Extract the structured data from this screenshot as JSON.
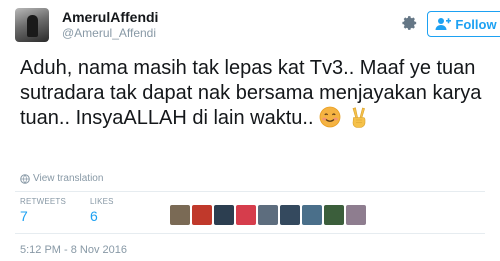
{
  "header": {
    "fullname": "AmerulAffendi",
    "username": "@Amerul_Affendi",
    "follow_label": "Follow"
  },
  "tweet": {
    "text": "Aduh, nama masih tak lepas kat Tv3.. Maaf ye tuan sutradara tak dapat nak bersama menjayakan karya tuan.. InsyaALLAH di lain waktu..",
    "emojis": [
      "smiling-face-emoji",
      "victory-hand-emoji"
    ]
  },
  "translate_label": "View translation",
  "stats": {
    "retweets_label": "RETWEETS",
    "retweets_count": "7",
    "likes_label": "LIKES",
    "likes_count": "6"
  },
  "likers": [
    {
      "name": "liker-avatar-1",
      "color": "#7a6a55"
    },
    {
      "name": "liker-avatar-2",
      "color": "#c0392b"
    },
    {
      "name": "liker-avatar-3",
      "color": "#2c3e50"
    },
    {
      "name": "liker-avatar-4",
      "color": "#d63d4c"
    },
    {
      "name": "liker-avatar-5",
      "color": "#5d6d7e"
    },
    {
      "name": "liker-avatar-6",
      "color": "#34495e"
    },
    {
      "name": "liker-avatar-7",
      "color": "#4a6f8a"
    },
    {
      "name": "liker-avatar-8",
      "color": "#3b5e3b"
    },
    {
      "name": "liker-avatar-9",
      "color": "#8e7d8f"
    }
  ],
  "timestamp": "5:12 PM - 8 Nov 2016",
  "colors": {
    "accent": "#1da1f2",
    "muted": "#8899a6",
    "text": "#14171a"
  }
}
